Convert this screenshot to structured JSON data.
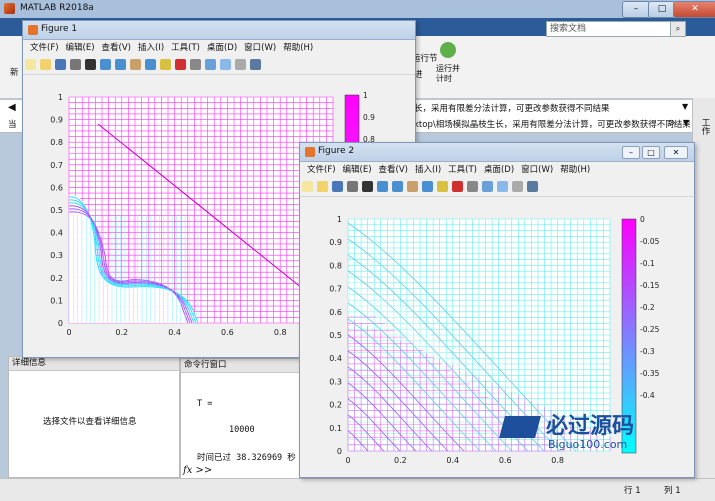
{
  "main": {
    "title": "MATLAB R2018a",
    "search_placeholder": "搜索文档",
    "addr1": "长，采用有限差分法计算，可更改参数获得不同结果",
    "addr2": "ktop\\相场模拟晶枝生长，采用有限差分法计算，可更改参数获得不同结果",
    "ribbon_run_section": "运行节",
    "ribbon_run_section2": "进",
    "ribbon_run_timer": "运行并计时",
    "ribbon_new": "新",
    "side_work": "工作",
    "side_cur": "当",
    "detail_title": "详细信息",
    "detail_msg": "选择文件以查看详细信息",
    "cmd_title": "命令行窗口",
    "cmd_lines": [
      "T =",
      "10000",
      "时间已过 38.326969 秒"
    ],
    "cmd_prompt": "fx >>",
    "status_row": "行 1",
    "status_col": "列 1"
  },
  "figure1": {
    "title": "Figure 1",
    "menus": [
      "文件(F)",
      "编辑(E)",
      "查看(V)",
      "插入(I)",
      "工具(T)",
      "桌面(D)",
      "窗口(W)",
      "帮助(H)"
    ],
    "colorbar_ticks": [
      "1",
      "0.9",
      "0.8"
    ],
    "yticks": [
      "1",
      "0.9",
      "0.8",
      "0.7",
      "0.6",
      "0.5",
      "0.4",
      "0.3",
      "0.2",
      "0.1",
      "0"
    ],
    "xticks": [
      "0",
      "0.2",
      "0.4",
      "0.6",
      "0.8"
    ]
  },
  "figure2": {
    "title": "Figure 2",
    "menus": [
      "文件(F)",
      "编辑(E)",
      "查看(V)",
      "插入(I)",
      "工具(T)",
      "桌面(D)",
      "窗口(W)",
      "帮助(H)"
    ],
    "colorbar_ticks": [
      "0",
      "-0.05",
      "-0.1",
      "-0.15",
      "-0.2",
      "-0.25",
      "-0.3",
      "-0.35",
      "-0.4"
    ],
    "yticks": [
      "1",
      "0.9",
      "0.8",
      "0.7",
      "0.6",
      "0.5",
      "0.4",
      "0.3",
      "0.2",
      "0.1",
      "0"
    ],
    "xticks": [
      "0",
      "0.2",
      "0.4",
      "0.6",
      "0.8"
    ]
  },
  "watermark": {
    "brand": "必过源码",
    "url": "Biguo100.com"
  },
  "colors": {
    "magenta": "#ff00ff",
    "cyan": "#00ffff",
    "titlebar": "#bed1e8"
  }
}
